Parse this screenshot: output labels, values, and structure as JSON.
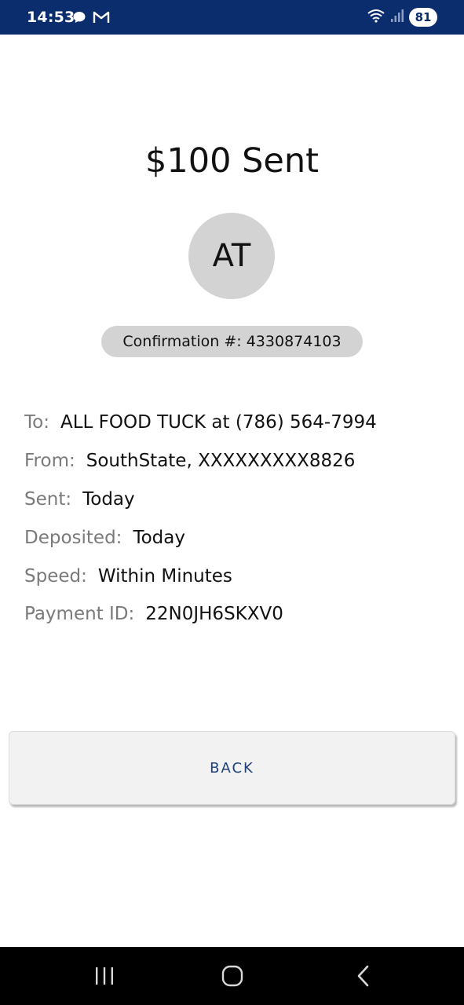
{
  "status_bar": {
    "time": "14:53",
    "battery": "81"
  },
  "main": {
    "title": "$100 Sent",
    "avatar_initials": "AT",
    "confirmation": "Confirmation #: 4330874103"
  },
  "details": [
    {
      "label": "To:",
      "value": "ALL FOOD TUCK at (786) 564-7994"
    },
    {
      "label": "From:",
      "value": "SouthState, XXXXXXXXX8826"
    },
    {
      "label": "Sent:",
      "value": "Today"
    },
    {
      "label": "Deposited:",
      "value": "Today"
    },
    {
      "label": "Speed:",
      "value": "Within Minutes"
    },
    {
      "label": "Payment ID:",
      "value": "22N0JH6SKXV0"
    }
  ],
  "actions": {
    "back_label": "BACK"
  },
  "colors": {
    "status_bar_bg": "#0b2d6e",
    "button_text": "#1e3f78",
    "label_gray": "#7a7a7a",
    "avatar_bg": "#d3d3d3"
  },
  "icons": {
    "status_left": [
      "chat-bubble-icon",
      "gmail-icon"
    ],
    "status_right": [
      "wifi-icon",
      "signal-icon",
      "battery-icon"
    ],
    "nav": [
      "recents-icon",
      "home-icon",
      "back-nav-icon"
    ]
  }
}
